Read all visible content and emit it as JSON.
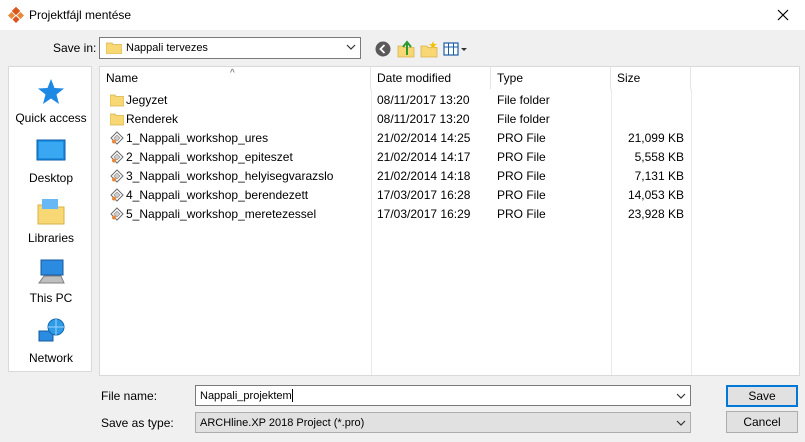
{
  "window": {
    "title": "Projektfájl mentése"
  },
  "save_in": {
    "label": "Save in:",
    "value": "Nappali tervezes"
  },
  "places": [
    {
      "label": "Quick access",
      "icon": "quick-access-star-icon"
    },
    {
      "label": "Desktop",
      "icon": "desktop-icon"
    },
    {
      "label": "Libraries",
      "icon": "libraries-icon"
    },
    {
      "label": "This PC",
      "icon": "this-pc-icon"
    },
    {
      "label": "Network",
      "icon": "network-icon"
    }
  ],
  "columns": {
    "name": "Name",
    "date": "Date modified",
    "type": "Type",
    "size": "Size"
  },
  "files": [
    {
      "name": "Jegyzet",
      "date": "08/11/2017 13:20",
      "type": "File folder",
      "size": "",
      "kind": "folder"
    },
    {
      "name": "Renderek",
      "date": "08/11/2017 13:20",
      "type": "File folder",
      "size": "",
      "kind": "folder"
    },
    {
      "name": "1_Nappali_workshop_ures",
      "date": "21/02/2014 14:25",
      "type": "PRO File",
      "size": "21,099 KB",
      "kind": "pro"
    },
    {
      "name": "2_Nappali_workshop_epiteszet",
      "date": "21/02/2014 14:17",
      "type": "PRO File",
      "size": "5,558 KB",
      "kind": "pro"
    },
    {
      "name": "3_Nappali_workshop_helyisegvarazslo",
      "date": "21/02/2014 14:18",
      "type": "PRO File",
      "size": "7,131 KB",
      "kind": "pro"
    },
    {
      "name": "4_Nappali_workshop_berendezett",
      "date": "17/03/2017 16:28",
      "type": "PRO File",
      "size": "14,053 KB",
      "kind": "pro"
    },
    {
      "name": "5_Nappali_workshop_meretezessel",
      "date": "17/03/2017 16:29",
      "type": "PRO File",
      "size": "23,928 KB",
      "kind": "pro"
    }
  ],
  "filename": {
    "label": "File name:",
    "value": "Nappali_projektem"
  },
  "filetype": {
    "label": "Save as type:",
    "value": "ARCHline.XP 2018 Project (*.pro)"
  },
  "buttons": {
    "save": "Save",
    "cancel": "Cancel"
  },
  "colors": {
    "accent": "#0078d7",
    "folder": "#f8d775"
  }
}
